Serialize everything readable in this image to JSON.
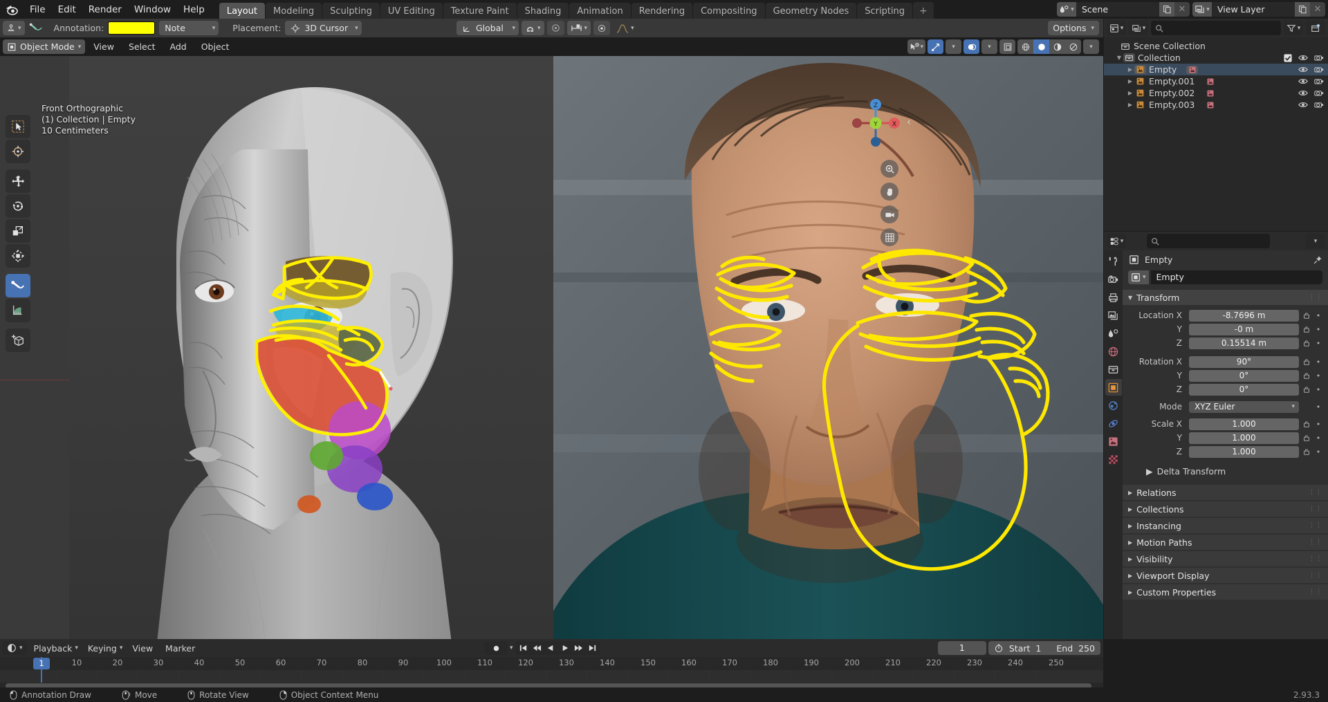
{
  "app": {
    "name": "Blender",
    "version": "2.93.3"
  },
  "topbar": {
    "menus": [
      "File",
      "Edit",
      "Render",
      "Window",
      "Help"
    ],
    "workspaces": [
      {
        "label": "Layout",
        "active": true
      },
      {
        "label": "Modeling",
        "active": false
      },
      {
        "label": "Sculpting",
        "active": false
      },
      {
        "label": "UV Editing",
        "active": false
      },
      {
        "label": "Texture Paint",
        "active": false
      },
      {
        "label": "Shading",
        "active": false
      },
      {
        "label": "Animation",
        "active": false
      },
      {
        "label": "Rendering",
        "active": false
      },
      {
        "label": "Compositing",
        "active": false
      },
      {
        "label": "Geometry Nodes",
        "active": false
      },
      {
        "label": "Scripting",
        "active": false
      }
    ],
    "add_workspace_label": "+",
    "scene": {
      "name": "Scene",
      "icon": "scene-icon"
    },
    "view_layer": {
      "name": "View Layer",
      "icon": "viewlayer-icon"
    }
  },
  "tool_settings": {
    "annotation_label": "Annotation:",
    "color": "#ffff00",
    "layer": "Note",
    "placement_label": "Placement:",
    "placement": "3D Cursor",
    "orientation": "Global",
    "options_label": "Options"
  },
  "viewport_header": {
    "mode": "Object Mode",
    "menus": [
      "View",
      "Select",
      "Add",
      "Object"
    ],
    "shading_modes": [
      "wireframe",
      "solid",
      "material-preview",
      "rendered"
    ],
    "active_shading": "solid"
  },
  "viewport": {
    "overlay_lines": [
      "Front Orthographic",
      "(1) Collection | Empty",
      "10 Centimeters"
    ],
    "gizmo_axes": [
      "X",
      "Y",
      "Z"
    ],
    "tools": [
      {
        "name": "tweak-tool",
        "label": "Tweak",
        "active": false
      },
      {
        "name": "cursor-tool",
        "label": "Cursor",
        "active": false
      },
      {
        "name": "move-tool",
        "label": "Move",
        "active": false
      },
      {
        "name": "rotate-tool",
        "label": "Rotate",
        "active": false
      },
      {
        "name": "scale-tool",
        "label": "Scale",
        "active": false
      },
      {
        "name": "transform-tool",
        "label": "Transform",
        "active": false
      },
      {
        "name": "annotate-tool",
        "label": "Annotate",
        "active": true
      },
      {
        "name": "measure-tool",
        "label": "Measure",
        "active": false
      },
      {
        "name": "add-cube-tool",
        "label": "Add Cube",
        "active": false
      }
    ],
    "nav_buttons": [
      "zoom-icon",
      "pan-hand-icon",
      "camera-icon",
      "grid-ortho-icon"
    ]
  },
  "outliner": {
    "search_placeholder": "",
    "display_mode": "View Layer",
    "rows": [
      {
        "label": "Scene Collection",
        "depth": 0,
        "icon": "collection-icon",
        "expandable": false,
        "selected": false,
        "checkbox": false,
        "eye": false,
        "camera": false
      },
      {
        "label": "Collection",
        "depth": 1,
        "icon": "collection-icon",
        "expandable": true,
        "selected": false,
        "checkbox": true,
        "eye": true,
        "camera": true
      },
      {
        "label": "Empty",
        "depth": 2,
        "icon": "empty-image-icon",
        "expandable": true,
        "selected": true,
        "checkbox": false,
        "eye": true,
        "camera": true,
        "data_icon": "image-data-icon"
      },
      {
        "label": "Empty.001",
        "depth": 2,
        "icon": "empty-image-icon",
        "expandable": true,
        "selected": false,
        "checkbox": false,
        "eye": true,
        "camera": true,
        "data_icon": "image-data-icon"
      },
      {
        "label": "Empty.002",
        "depth": 2,
        "icon": "empty-image-icon",
        "expandable": true,
        "selected": false,
        "checkbox": false,
        "eye": true,
        "camera": true,
        "data_icon": "image-data-icon"
      },
      {
        "label": "Empty.003",
        "depth": 2,
        "icon": "empty-image-icon",
        "expandable": true,
        "selected": false,
        "checkbox": false,
        "eye": true,
        "camera": true,
        "data_icon": "image-data-icon"
      }
    ]
  },
  "properties": {
    "search_placeholder": "",
    "tabs": [
      {
        "name": "tool-tab",
        "icon": "tool-icon",
        "selected": false
      },
      {
        "name": "render-tab",
        "icon": "render-camera-icon",
        "selected": false
      },
      {
        "name": "output-tab",
        "icon": "printer-icon",
        "selected": false
      },
      {
        "name": "viewlayer-tab",
        "icon": "images-icon",
        "selected": false
      },
      {
        "name": "scene-tab",
        "icon": "scene-cone-icon",
        "selected": false
      },
      {
        "name": "world-tab",
        "icon": "world-globe-icon",
        "selected": false
      },
      {
        "name": "collection-tab",
        "icon": "collection-box-icon",
        "selected": false
      },
      {
        "name": "object-tab",
        "icon": "object-square-icon",
        "selected": true
      },
      {
        "name": "constraints-tab",
        "icon": "constraint-icon",
        "selected": false
      },
      {
        "name": "physics-tab",
        "icon": "physics-orbit-icon",
        "selected": false
      },
      {
        "name": "object-data-tab",
        "icon": "object-data-image-icon",
        "selected": false
      },
      {
        "name": "texture-tab",
        "icon": "texture-checker-icon",
        "selected": false
      }
    ],
    "breadcrumb": "Empty",
    "id_name": "Empty",
    "panels": [
      {
        "label": "Transform",
        "open": true
      },
      {
        "label": "Delta Transform",
        "open": false,
        "sub": true
      },
      {
        "label": "Relations",
        "open": false
      },
      {
        "label": "Collections",
        "open": false
      },
      {
        "label": "Instancing",
        "open": false
      },
      {
        "label": "Motion Paths",
        "open": false
      },
      {
        "label": "Visibility",
        "open": false
      },
      {
        "label": "Viewport Display",
        "open": false
      },
      {
        "label": "Custom Properties",
        "open": false
      }
    ],
    "transform": {
      "location": {
        "label": "Location X",
        "x": "-8.7696 m",
        "y": "-0 m",
        "z": "0.15514 m"
      },
      "rotation": {
        "label": "Rotation X",
        "x": "90°",
        "y": "0°",
        "z": "0°"
      },
      "mode": {
        "label": "Mode",
        "value": "XYZ Euler"
      },
      "scale": {
        "label": "Scale X",
        "x": "1.000",
        "y": "1.000",
        "z": "1.000"
      },
      "axis_y": "Y",
      "axis_z": "Z"
    }
  },
  "timeline": {
    "menus": [
      "Playback",
      "Keying",
      "View",
      "Marker"
    ],
    "current_frame": "1",
    "start_label": "Start",
    "start_value": "1",
    "end_label": "End",
    "end_value": "250",
    "ticks": [
      "1",
      "10",
      "20",
      "30",
      "40",
      "50",
      "60",
      "70",
      "80",
      "90",
      "100",
      "110",
      "120",
      "130",
      "140",
      "150",
      "160",
      "170",
      "180",
      "190",
      "200",
      "210",
      "220",
      "230",
      "240",
      "250"
    ],
    "playhead_frame": "1"
  },
  "statusbar": {
    "items": [
      {
        "icon": "mouse-left-icon",
        "label": "Annotation Draw"
      },
      {
        "icon": "mouse-middle-icon",
        "label": "Move"
      },
      {
        "icon": "mouse-middle-icon",
        "label": "Rotate View"
      },
      {
        "icon": "mouse-right-icon",
        "label": "Object Context Menu"
      }
    ],
    "version": "2.93.3"
  },
  "colors": {
    "accent": "#4772b3",
    "annotation": "#ffff00",
    "header": "#2b2b2b",
    "panel": "#303030",
    "axis_x": "#e04a4a",
    "axis_y": "#9fd63c",
    "axis_z": "#3e8fd6"
  }
}
